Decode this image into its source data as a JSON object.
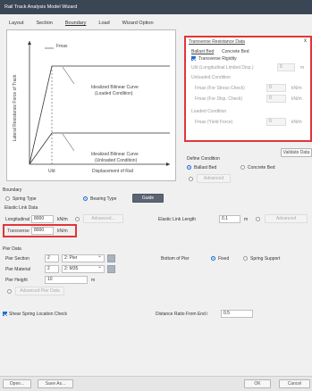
{
  "window": {
    "title": "Rail Track Analysis Model Wizard"
  },
  "tabs": [
    "Layout",
    "Section",
    "Boundary",
    "Load",
    "Wizard Option"
  ],
  "diagram": {
    "fmax_label": "Fmax",
    "yaxis_label": "Lateral Resistance Force of Track",
    "xaxis_label": "Displacement of Rail",
    "uld_label": "Uld",
    "curve_loaded": [
      "Idealized Bilinear Curve",
      "(Loaded Condition)"
    ],
    "curve_unloaded": [
      "Idealized Bilinear Curve",
      "(Unloaded Condition)"
    ]
  },
  "transverse_panel": {
    "title": "Transverse Resistance Data",
    "close": "x",
    "tab_ballast": "Ballast Bed",
    "tab_concrete": "Concrete Bed",
    "rigidity_label": "Transverse Rigidity",
    "uld_label": "Uld (Longitudinal Limited Disp.)",
    "uld_value": "0",
    "uld_unit": "m",
    "unloaded_title": "Unloaded Condition",
    "fmax_stress_label": "Fmax (For Stress Check)",
    "fmax_stress_value": "0",
    "fmax_stress_unit": "kN/m",
    "fmax_disp_label": "Fmax (For Disp. Check)",
    "fmax_disp_value": "0",
    "fmax_disp_unit": "kN/m",
    "loaded_title": "Loaded Condition",
    "fmax_yield_label": "Fmax (Yield Force)",
    "fmax_yield_value": "0",
    "fmax_yield_unit": "kN/m"
  },
  "validate_button": "Validate Data",
  "define_condition": {
    "label": "Define Condition",
    "ballast": "Ballast Bed",
    "concrete": "Concrete Bed",
    "advanced": "Advanced"
  },
  "boundary": {
    "section": "Boundary",
    "spring_type": "Spring Type",
    "bearing_type": "Bearing Type",
    "guide_button": "Guide",
    "elastic_link_data": "Elastic Link Data",
    "longitudinal_label": "Longitudinal",
    "longitudinal_value": "8000",
    "longitudinal_unit": "kN/m",
    "advanced": "Advanced...",
    "elastic_link_length_label": "Elastic Link Length",
    "elastic_link_length_value": "0.1",
    "elastic_link_length_unit": "m",
    "advanced2": "Advanced",
    "transverse_label": "Transverse",
    "transverse_value": "8000",
    "transverse_unit": "kN/m"
  },
  "pier": {
    "section": "Pier Data",
    "section_label": "Pier Section",
    "section_value": "2",
    "section_select": "2: Pier",
    "material_label": "Pier Material",
    "material_value": "2",
    "material_select": "2: M35",
    "height_label": "Pier Height",
    "height_value": "10",
    "height_unit": "m",
    "advanced": "Advanced Pier Data",
    "bottom_label": "Bottom of Pier",
    "fixed": "Fixed",
    "spring_support": "Spring Support"
  },
  "shear_spring": {
    "label": "Shear Spring Location Check",
    "distance_label": "Distance Ratio From End i",
    "distance_value": "0.5"
  },
  "footer": {
    "open": "Open...",
    "save_as": "Save As...",
    "ok": "OK",
    "cancel": "Cancel"
  },
  "colors": {
    "titlebar": "#3b4655",
    "highlight": "#e0363a",
    "accent": "#1d6fd6"
  }
}
